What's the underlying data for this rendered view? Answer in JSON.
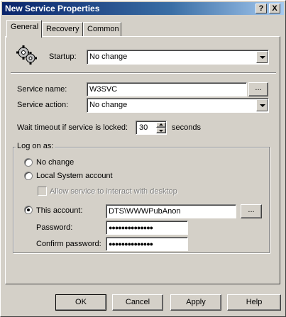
{
  "window": {
    "title": "New Service Properties",
    "help_btn": "?",
    "close_btn": "X"
  },
  "tabs": [
    {
      "label": "General"
    },
    {
      "label": "Recovery"
    },
    {
      "label": "Common"
    }
  ],
  "general": {
    "startup_label": "Startup:",
    "startup_value": "No change",
    "service_name_label": "Service name:",
    "service_name_value": "W3SVC",
    "browse_label": "...",
    "service_action_label": "Service action:",
    "service_action_value": "No change",
    "wait_label": "Wait timeout if service is locked:",
    "wait_value": "30",
    "wait_unit": "seconds",
    "logon": {
      "legend": "Log on as:",
      "no_change": "No change",
      "local_system": "Local System account",
      "allow_interact": "Allow service to interact with desktop",
      "this_account": "This account:",
      "account_value": "DTS\\WWWPubAnon",
      "account_browse": "...",
      "password_label": "Password:",
      "password_value": "●●●●●●●●●●●●●●",
      "confirm_label": "Confirm password:",
      "confirm_value": "●●●●●●●●●●●●●●",
      "selected": "this_account"
    }
  },
  "buttons": {
    "ok": "OK",
    "cancel": "Cancel",
    "apply": "Apply",
    "help": "Help"
  }
}
